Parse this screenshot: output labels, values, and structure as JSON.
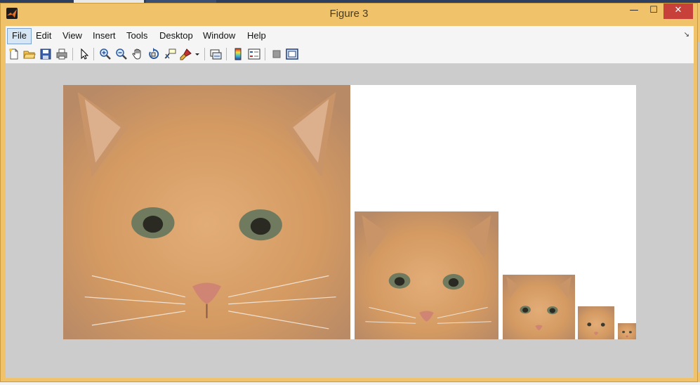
{
  "window": {
    "title": "Figure 3",
    "minimize_glyph": "—",
    "maximize_glyph": "☐",
    "close_glyph": "✕"
  },
  "menu": {
    "items": [
      "File",
      "Edit",
      "View",
      "Insert",
      "Tools",
      "Desktop",
      "Window",
      "Help"
    ],
    "active": "File",
    "dock_glyph": "↘"
  },
  "toolbar": {
    "icons": [
      "new-figure-icon",
      "open-file-icon",
      "save-icon",
      "print-icon",
      "select-arrow-icon",
      "zoom-in-icon",
      "zoom-out-icon",
      "pan-hand-icon",
      "rotate-3d-icon",
      "data-cursor-icon",
      "brush-icon",
      "brush-dropdown-icon",
      "link-plot-icon",
      "colorbar-icon",
      "legend-icon",
      "hide-plot-tools-icon",
      "show-plot-tools-icon"
    ]
  },
  "figure": {
    "description_images": [
      "cat-image-level-1",
      "cat-image-level-2",
      "cat-image-level-3",
      "cat-image-level-4",
      "cat-image-level-5"
    ],
    "colors": {
      "figure_background": "#cccccc",
      "axes_background": "#ffffff",
      "fur": "#d9a26a",
      "window_frame": "#f0c36a",
      "close_button": "#c7403a"
    }
  }
}
